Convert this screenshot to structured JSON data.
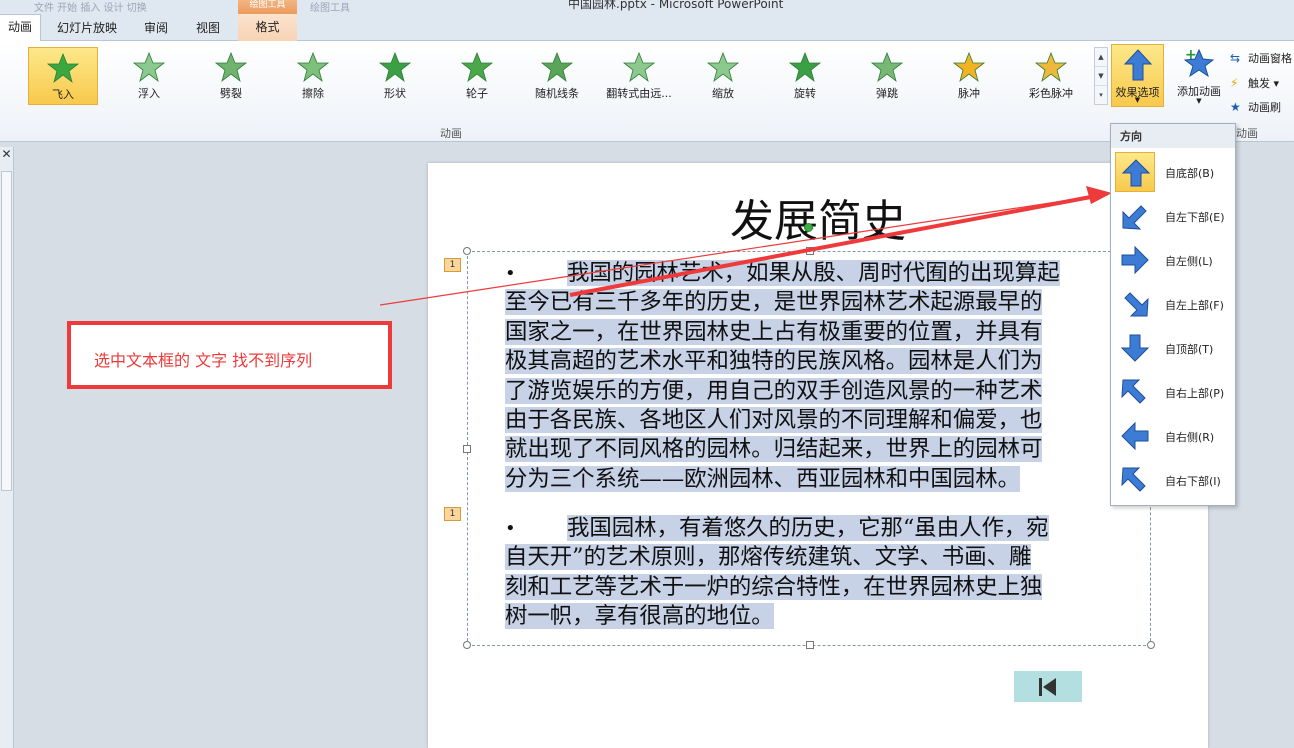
{
  "window": {
    "title": "中国园林.pptx - Microsoft PowerPoint",
    "ghost_text_left": "文件 开始 插入 设计 切换",
    "ghost_text_right": "绘图工具"
  },
  "tabs": [
    {
      "label": "动画",
      "active": true
    },
    {
      "label": "幻灯片放映"
    },
    {
      "label": "审阅"
    },
    {
      "label": "视图"
    }
  ],
  "context_tab": {
    "group": "绘图工具",
    "label": "格式"
  },
  "gallery": [
    {
      "label": "飞入",
      "selected": true
    },
    {
      "label": "浮入"
    },
    {
      "label": "劈裂"
    },
    {
      "label": "擦除"
    },
    {
      "label": "形状"
    },
    {
      "label": "轮子"
    },
    {
      "label": "随机线条"
    },
    {
      "label": "翻转式由远..."
    },
    {
      "label": "缩放"
    },
    {
      "label": "旋转"
    },
    {
      "label": "弹跳"
    },
    {
      "label": "脉冲"
    },
    {
      "label": "彩色脉冲"
    }
  ],
  "ribbon": {
    "group_animation": "动画",
    "group_advanced": "动画",
    "effect_options": "效果选项",
    "add_animation": "添加动画",
    "anim_pane": "动画窗格",
    "trigger": "触发",
    "anim_painter": "动画刷"
  },
  "direction_menu": {
    "header": "方向",
    "items": [
      {
        "label": "自底部(B)",
        "selected": true
      },
      {
        "label": "自左下部(E)"
      },
      {
        "label": "自左侧(L)"
      },
      {
        "label": "自左上部(F)"
      },
      {
        "label": "自顶部(T)"
      },
      {
        "label": "自右上部(P)"
      },
      {
        "label": "自右侧(R)"
      },
      {
        "label": "自右下部(I)"
      }
    ]
  },
  "slide": {
    "title": "发展简史",
    "anim_tag_1": "1",
    "anim_tag_2": "1",
    "bullet": "•",
    "para1_lines": [
      "我国的园林艺术，如果从殷、周时代囿的出现算起",
      "至今已有三千多年的历史，是世界园林艺术起源最早的",
      "国家之一，在世界园林史上占有极重要的位置，并具有",
      "极其高超的艺术水平和独特的民族风格。园林是人们为",
      "了游览娱乐的方便，用自己的双手创造风景的一种艺术",
      "由于各民族、各地区人们对风景的不同理解和偏爱，也",
      "就出现了不同风格的园林。归结起来，世界上的园林可",
      "分为三个系统——欧洲园林、西亚园林和中国园林。"
    ],
    "para2_lines": [
      "我国园林，有着悠久的历史，它那“虽由人作，宛",
      "自天开”的艺术原则，那熔传统建筑、文学、书画、雕",
      "刻和工艺等艺术于一炉的综合特性，在世界园林史上独",
      "树一帜，享有很高的地位。"
    ]
  },
  "annotation": {
    "text": "选中文本框的  文字 找不到序列",
    "color": "#ee3a3a"
  },
  "colors": {
    "selection": "#c7d2e7",
    "highlight": "#f8c94c",
    "nav_button": "#b4dfe0"
  }
}
